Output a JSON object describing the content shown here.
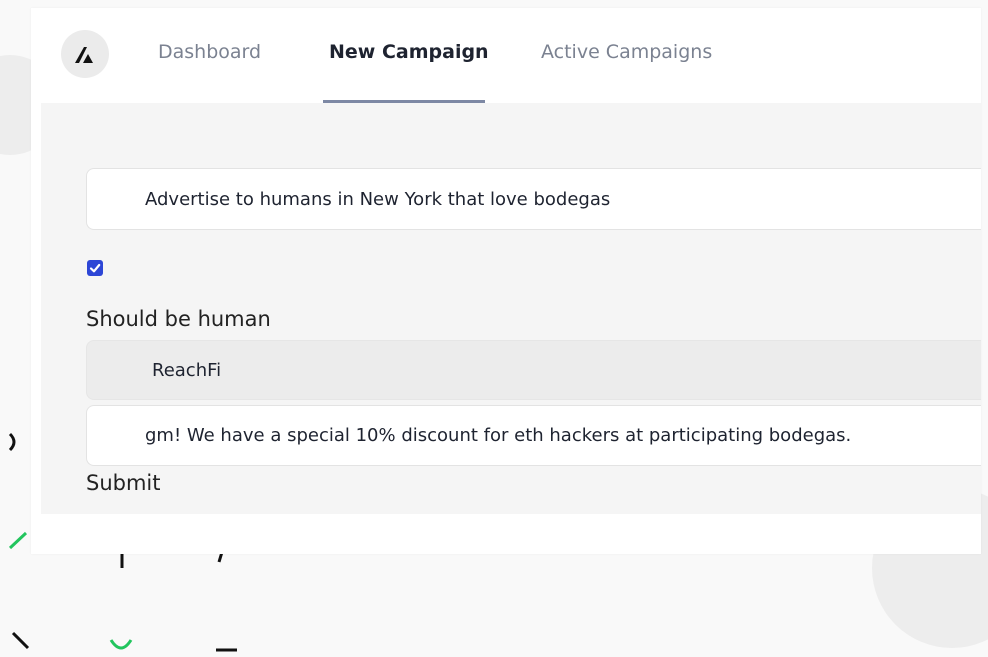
{
  "nav": {
    "logo_icon": "reachfi-logo-icon",
    "tabs": [
      {
        "label": "Dashboard",
        "active": false
      },
      {
        "label": "New Campaign",
        "active": true
      },
      {
        "label": "Active Campaigns",
        "active": false
      }
    ]
  },
  "form": {
    "audience_value": "Advertise to humans in New York that love bodegas",
    "human_checked": true,
    "human_label": "Should be human",
    "sender_value": "ReachFi",
    "message_value": "gm! We have a special 10% discount for eth hackers at participating bodegas.",
    "submit_label": "Submit"
  },
  "colors": {
    "accent": "#2d46d6",
    "active_tab_underline": "#7d88a4",
    "decor_green": "#22c55e"
  }
}
